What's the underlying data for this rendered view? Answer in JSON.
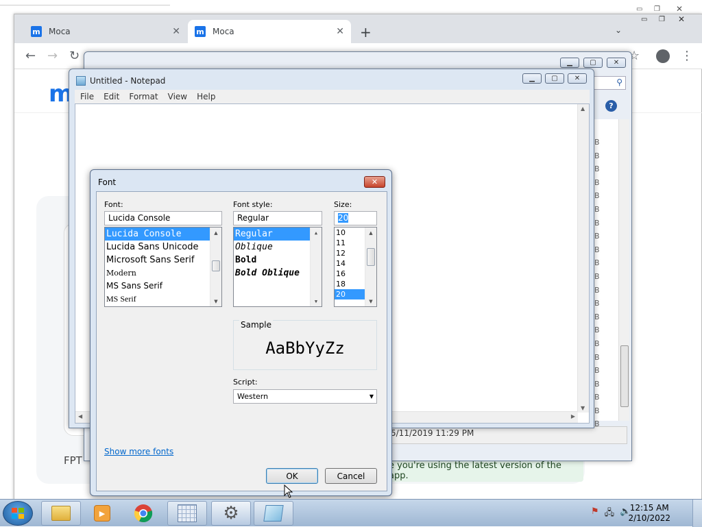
{
  "browser": {
    "tabs": [
      {
        "title": "Moca",
        "favicon": "m"
      },
      {
        "title": "Moca",
        "favicon": "m"
      }
    ],
    "page": {
      "logo_letter": "m",
      "date_text": "5/11/2019 11:29 PM",
      "fpt_text": "FPT",
      "update_banner": "e you're using the latest version of the app.",
      "partial_col_letter": "B"
    }
  },
  "notepad": {
    "title": "Untitled - Notepad",
    "menu": [
      "File",
      "Edit",
      "Format",
      "View",
      "Help"
    ]
  },
  "font_dialog": {
    "title": "Font",
    "font_label": "Font:",
    "font_value": "Lucida Console",
    "fonts": [
      "Lucida Console",
      "Lucida Sans Unicode",
      "Microsoft Sans Serif",
      "Modern",
      "MS Sans Serif",
      "MS Serif"
    ],
    "selected_font": "Lucida Console",
    "style_label": "Font style:",
    "style_value": "Regular",
    "styles": [
      "Regular",
      "Oblique",
      "Bold",
      "Bold Oblique"
    ],
    "size_label": "Size:",
    "size_value": "20",
    "sizes": [
      "10",
      "11",
      "12",
      "14",
      "16",
      "18",
      "20"
    ],
    "sample_label": "Sample",
    "sample_text": "AaBbYyZz",
    "script_label": "Script:",
    "script_value": "Western",
    "show_more_link": "Show more fonts",
    "ok_label": "OK",
    "cancel_label": "Cancel"
  },
  "taskbar": {
    "time": "12:15 AM",
    "date": "2/10/2022",
    "apps": [
      "explorer-icon",
      "media-player-icon",
      "chrome-icon",
      "calendar-icon",
      "settings-icon",
      "notepad-icon"
    ]
  },
  "colors": {
    "selection": "#3399ff",
    "link": "#0066cc",
    "update_banner_bg": "#e6f4ea"
  }
}
